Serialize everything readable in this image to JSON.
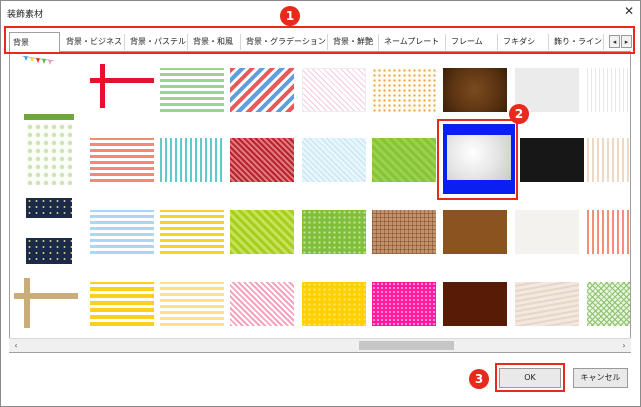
{
  "window": {
    "title": "装飾素材",
    "close_glyph": "✕"
  },
  "tabs": [
    "背景",
    "背景・ビジネス",
    "背景・パステル",
    "背景・和風",
    "背景・グラデーション",
    "背景・鮮艶",
    "ネームプレート",
    "フレーム",
    "フキダシ",
    "飾り・ライン"
  ],
  "active_tab": "背景",
  "tab_arrows": {
    "left": "◂",
    "right": "▸"
  },
  "scrollbar": {
    "left": "‹",
    "right": "›"
  },
  "buttons": {
    "ok": "OK",
    "cancel": "キャンセル"
  },
  "annotations": {
    "one": "1",
    "two": "2",
    "three": "3"
  },
  "colors": {
    "accent": "#e8291c",
    "selected_frame": "#0a1ff0"
  },
  "grid_patterns": [
    [
      "bunting-flags",
      "cross-red-ribbon",
      "green-horizontal-stripes",
      "red-blue-diagonal-stripes",
      "pink-diagonal-lines",
      "orange-dots",
      "brown-leather",
      "light-gray-plain",
      "white-vertical-stripes"
    ],
    [
      "green-floral-vertical",
      "coral-horizontal-stripes",
      "teal-vertical-stripes",
      "red-diagonal-stripes",
      "light-blue-diagonal",
      "green-diamond",
      "blue-marble-frame",
      "black-plain",
      "beige-vertical-stripes"
    ],
    [
      "night-sky-stars",
      "light-blue-stripes",
      "yellow-horizontal-stripes",
      "lime-diagonal-stripes",
      "green-dots",
      "brown-plaid",
      "brown-plain",
      "white-paper",
      "coral-vertical-stripes"
    ],
    [
      "tan-cross-ribbon",
      "yellow-stripes",
      "yellow-white-stripes",
      "pink-diagonal-stripes",
      "yellow-dots",
      "magenta-dots",
      "dark-brown-plain",
      "wood-grain",
      "green-crosshatch"
    ]
  ]
}
